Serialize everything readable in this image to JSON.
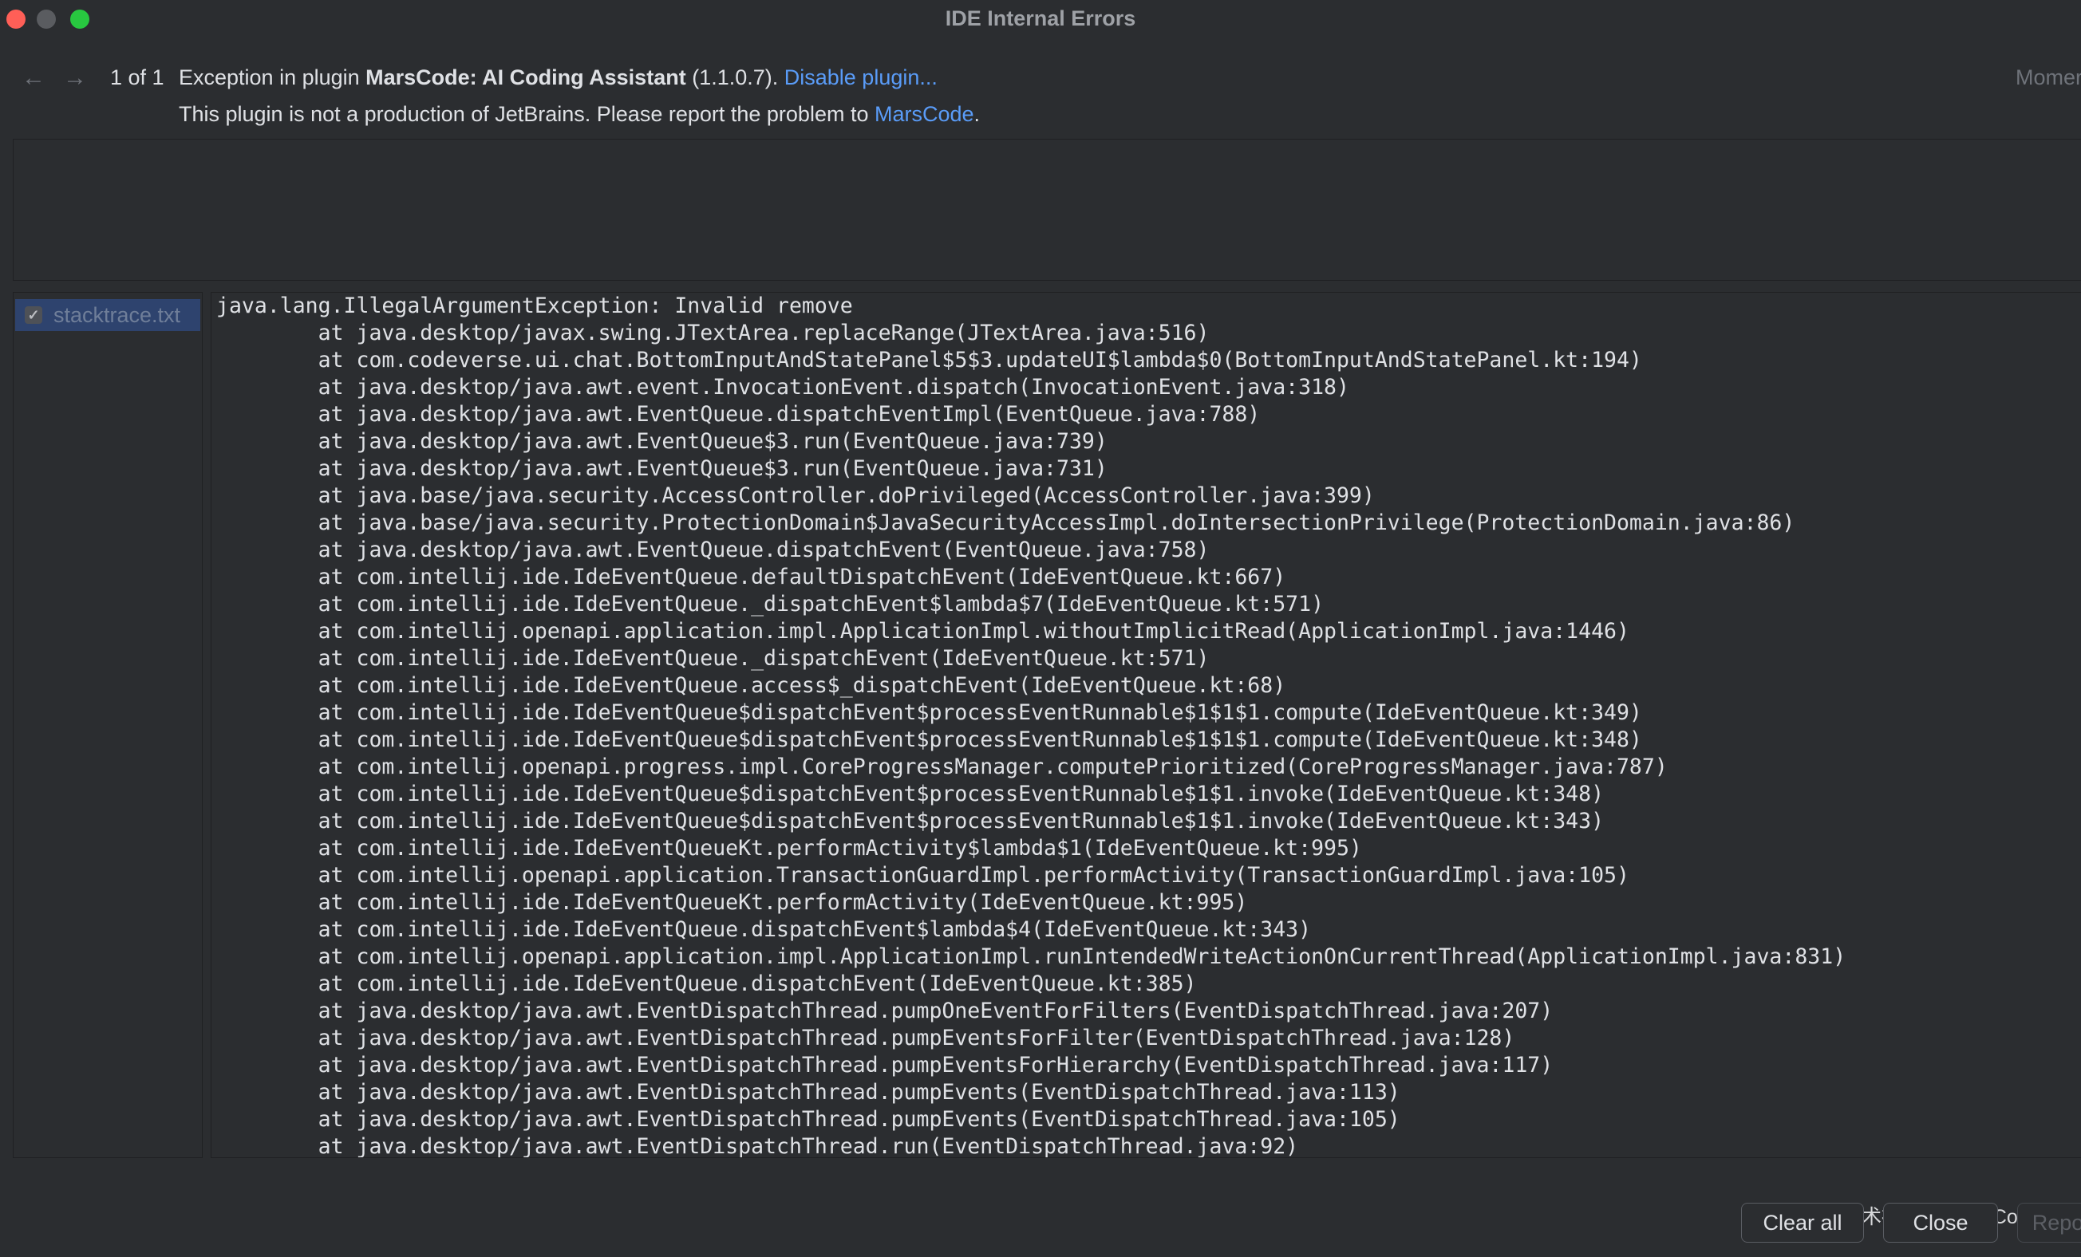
{
  "window": {
    "title": "IDE Internal Errors"
  },
  "header": {
    "back_arrow": "←",
    "forward_arrow": "→",
    "counter": "1 of 1",
    "msg_prefix": "Exception in plugin ",
    "plugin_name": "MarsCode: AI Coding Assistant",
    "plugin_version": " (1.1.0.7). ",
    "disable_link": "Disable plugin...",
    "right_cut_text": "Momer",
    "sub_prefix": "This plugin is not a production of JetBrains. Please report the problem to ",
    "sub_link": "MarsCode",
    "sub_suffix": "."
  },
  "attachments": [
    {
      "label": "stacktrace.txt",
      "checked": true,
      "check_glyph": "✓"
    }
  ],
  "stacktrace": [
    "java.lang.IllegalArgumentException: Invalid remove",
    "\tat java.desktop/javax.swing.JTextArea.replaceRange(JTextArea.java:516)",
    "\tat com.codeverse.ui.chat.BottomInputAndStatePanel$5$3.updateUI$lambda$0(BottomInputAndStatePanel.kt:194)",
    "\tat java.desktop/java.awt.event.InvocationEvent.dispatch(InvocationEvent.java:318)",
    "\tat java.desktop/java.awt.EventQueue.dispatchEventImpl(EventQueue.java:788)",
    "\tat java.desktop/java.awt.EventQueue$3.run(EventQueue.java:739)",
    "\tat java.desktop/java.awt.EventQueue$3.run(EventQueue.java:731)",
    "\tat java.base/java.security.AccessController.doPrivileged(AccessController.java:399)",
    "\tat java.base/java.security.ProtectionDomain$JavaSecurityAccessImpl.doIntersectionPrivilege(ProtectionDomain.java:86)",
    "\tat java.desktop/java.awt.EventQueue.dispatchEvent(EventQueue.java:758)",
    "\tat com.intellij.ide.IdeEventQueue.defaultDispatchEvent(IdeEventQueue.kt:667)",
    "\tat com.intellij.ide.IdeEventQueue._dispatchEvent$lambda$7(IdeEventQueue.kt:571)",
    "\tat com.intellij.openapi.application.impl.ApplicationImpl.withoutImplicitRead(ApplicationImpl.java:1446)",
    "\tat com.intellij.ide.IdeEventQueue._dispatchEvent(IdeEventQueue.kt:571)",
    "\tat com.intellij.ide.IdeEventQueue.access$_dispatchEvent(IdeEventQueue.kt:68)",
    "\tat com.intellij.ide.IdeEventQueue$dispatchEvent$processEventRunnable$1$1$1.compute(IdeEventQueue.kt:349)",
    "\tat com.intellij.ide.IdeEventQueue$dispatchEvent$processEventRunnable$1$1$1.compute(IdeEventQueue.kt:348)",
    "\tat com.intellij.openapi.progress.impl.CoreProgressManager.computePrioritized(CoreProgressManager.java:787)",
    "\tat com.intellij.ide.IdeEventQueue$dispatchEvent$processEventRunnable$1$1.invoke(IdeEventQueue.kt:348)",
    "\tat com.intellij.ide.IdeEventQueue$dispatchEvent$processEventRunnable$1$1.invoke(IdeEventQueue.kt:343)",
    "\tat com.intellij.ide.IdeEventQueueKt.performActivity$lambda$1(IdeEventQueue.kt:995)",
    "\tat com.intellij.openapi.application.TransactionGuardImpl.performActivity(TransactionGuardImpl.java:105)",
    "\tat com.intellij.ide.IdeEventQueueKt.performActivity(IdeEventQueue.kt:995)",
    "\tat com.intellij.ide.IdeEventQueue.dispatchEvent$lambda$4(IdeEventQueue.kt:343)",
    "\tat com.intellij.openapi.application.impl.ApplicationImpl.runIntendedWriteActionOnCurrentThread(ApplicationImpl.java:831)",
    "\tat com.intellij.ide.IdeEventQueue.dispatchEvent(IdeEventQueue.kt:385)",
    "\tat java.desktop/java.awt.EventDispatchThread.pumpOneEventForFilters(EventDispatchThread.java:207)",
    "\tat java.desktop/java.awt.EventDispatchThread.pumpEventsForFilter(EventDispatchThread.java:128)",
    "\tat java.desktop/java.awt.EventDispatchThread.pumpEventsForHierarchy(EventDispatchThread.java:117)",
    "\tat java.desktop/java.awt.EventDispatchThread.pumpEvents(EventDispatchThread.java:113)",
    "\tat java.desktop/java.awt.EventDispatchThread.pumpEvents(EventDispatchThread.java:105)",
    "\tat java.desktop/java.awt.EventDispatchThread.run(EventDispatchThread.java:92)"
  ],
  "buttons": {
    "clear_all": "Clear all",
    "close": "Close",
    "report": "Repo"
  },
  "watermark": "掘金技术社区 @ VibeCoder",
  "colors": {
    "background": "#2b2d30",
    "link": "#5a9cf8",
    "selection": "#2e436e",
    "traffic_red": "#ff5f57",
    "traffic_green": "#28c840"
  }
}
